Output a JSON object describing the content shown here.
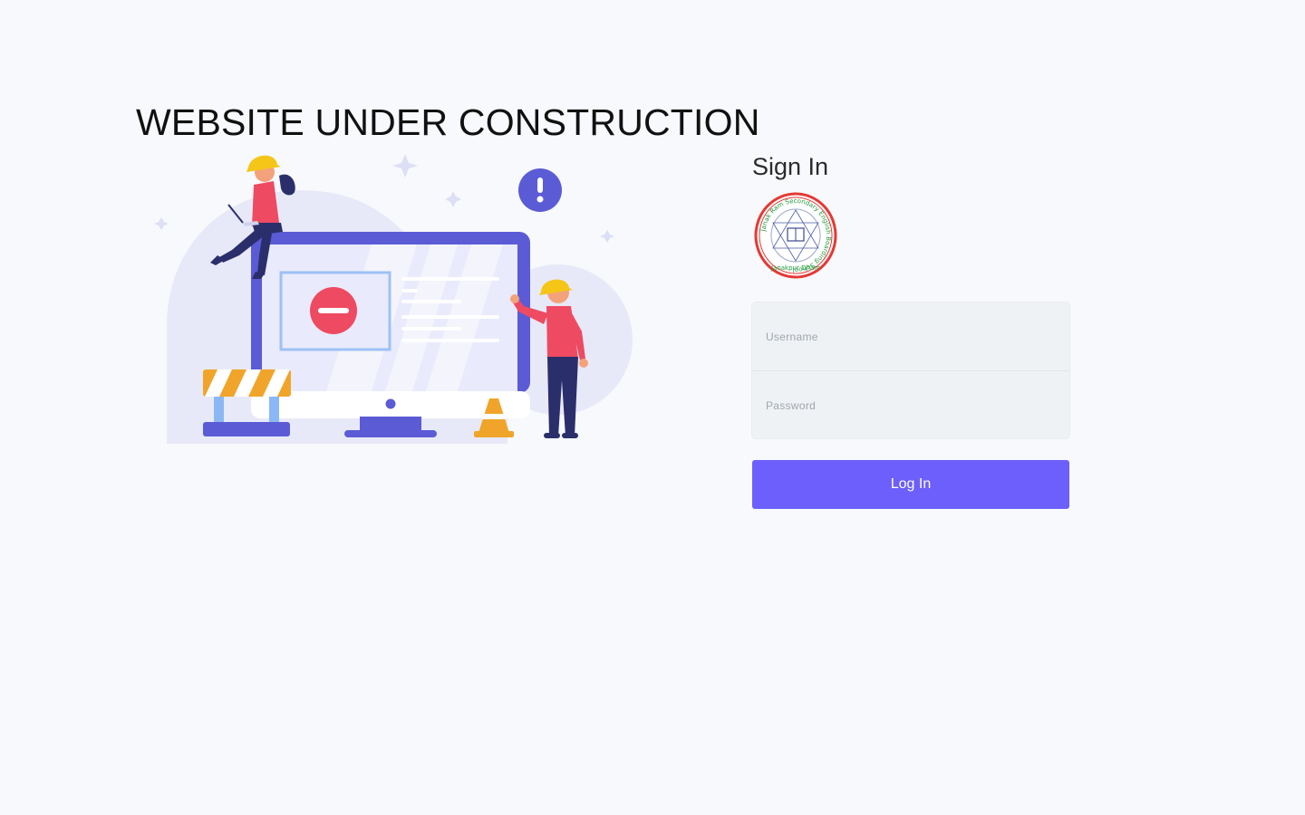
{
  "headline": "WEBSITE UNDER CONSTRUCTION",
  "signin": {
    "title": "Sign In",
    "logo": {
      "ring_text": "Janak Ram Secondary English Boarding School",
      "bottom_text": "Janakpur Dham",
      "ring_color": "#e53935",
      "text_color": "#1f9a3a"
    },
    "username": {
      "placeholder": "Username",
      "value": ""
    },
    "password": {
      "placeholder": "Password",
      "value": ""
    },
    "login_label": "Log In"
  },
  "illustration": {
    "alert_icon": "exclamation-icon",
    "block_icon": "minus-circle-icon",
    "accent": "#5b5bd6",
    "warning": "#f0a52a",
    "danger": "#ee4a62"
  },
  "colors": {
    "background": "#f7f9fc",
    "primary_button": "#6c5ffc",
    "input_bg": "#eef2f5"
  }
}
